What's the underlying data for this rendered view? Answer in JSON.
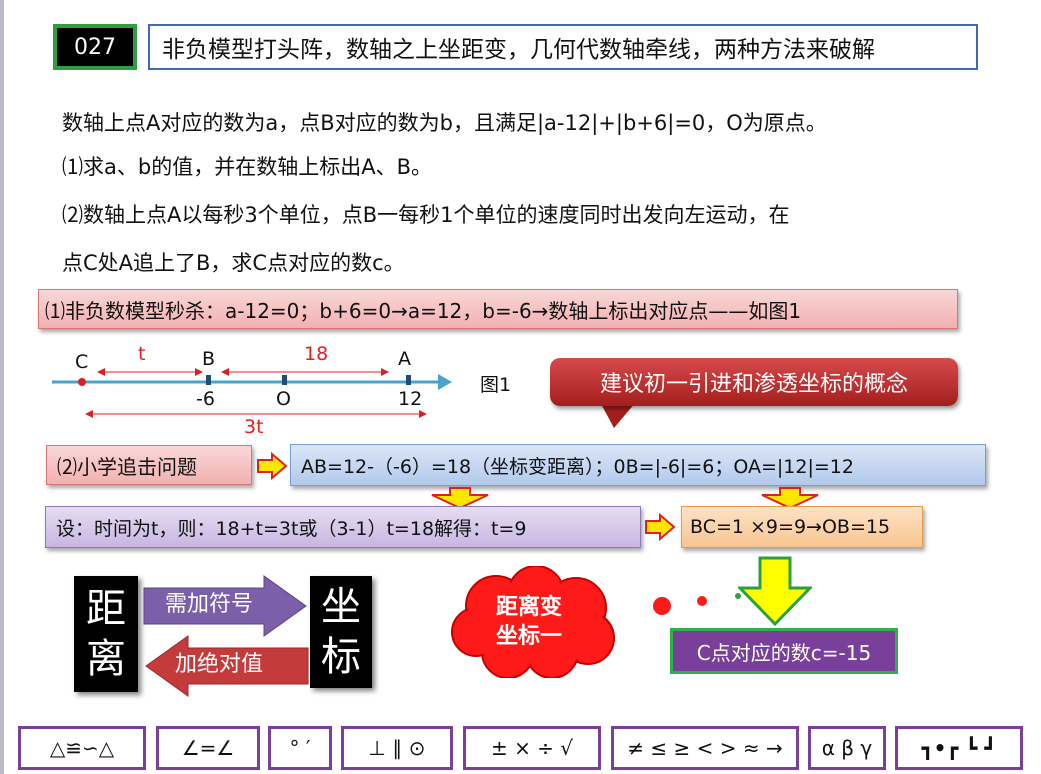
{
  "header": {
    "number": "027",
    "title": "非负模型打头阵，数轴之上坐距变，几何代数轴牵线，两种方法来破解"
  },
  "problem": {
    "line1": "数轴上点A对应的数为a，点B对应的数为b，且满足|a-12|+|b+6|=0，O为原点。",
    "line2": "⑴求a、b的值，并在数轴上标出A、B。",
    "line3": "⑵数轴上点A以每秒3个单位，点B一每秒1个单位的速度同时出发向左运动，在",
    "line4": "点C处A追上了B，求C点对应的数c。"
  },
  "step1": "⑴非负数模型秒杀：a-12=0；b+6=0→a=12，b=-6→数轴上标出对应点——如图1",
  "numberline": {
    "label_c": "C",
    "label_b": "B",
    "label_a": "A",
    "dist_t": "t",
    "dist_18": "18",
    "tick_neg6": "-6",
    "tick_o": "O",
    "tick_12": "12",
    "dist_3t": "3t",
    "fig_label": "图1"
  },
  "callout": "建议初一引进和渗透坐标的概念",
  "step2_label": "⑵小学追击问题",
  "step2_formula": "AB=12-（-6）=18（坐标变距离）；0B=|-6|=6；OA=|12|=12",
  "step3": "设：时间为t，则：18+t=3t或（3-1）t=18解得：t=9",
  "step4": "BC=1 ×9=9→OB=15",
  "answer": "C点对应的数c=-15",
  "concept": {
    "left_block": [
      "距",
      "离"
    ],
    "right_block": [
      "坐",
      "标"
    ],
    "arrow_right_label": "需加符号",
    "arrow_left_label": "加绝对值",
    "cloud_line1": "距离变",
    "cloud_line2": "坐标一"
  },
  "toolbar": [
    "△≌∽△",
    "∠=∠",
    "° ′",
    "⊥ ∥ ⊙",
    "± × ÷ √",
    "≠ ≤ ≥ < > ≈ →",
    "α β γ",
    "┓•┏ ┗ ┛"
  ],
  "colors": {
    "accent_green": "#2e9e3e",
    "title_border": "#3f69b0",
    "axis": "#4aa3c8",
    "red": "#e02020",
    "toolbar_border": "#7a3f9a"
  }
}
